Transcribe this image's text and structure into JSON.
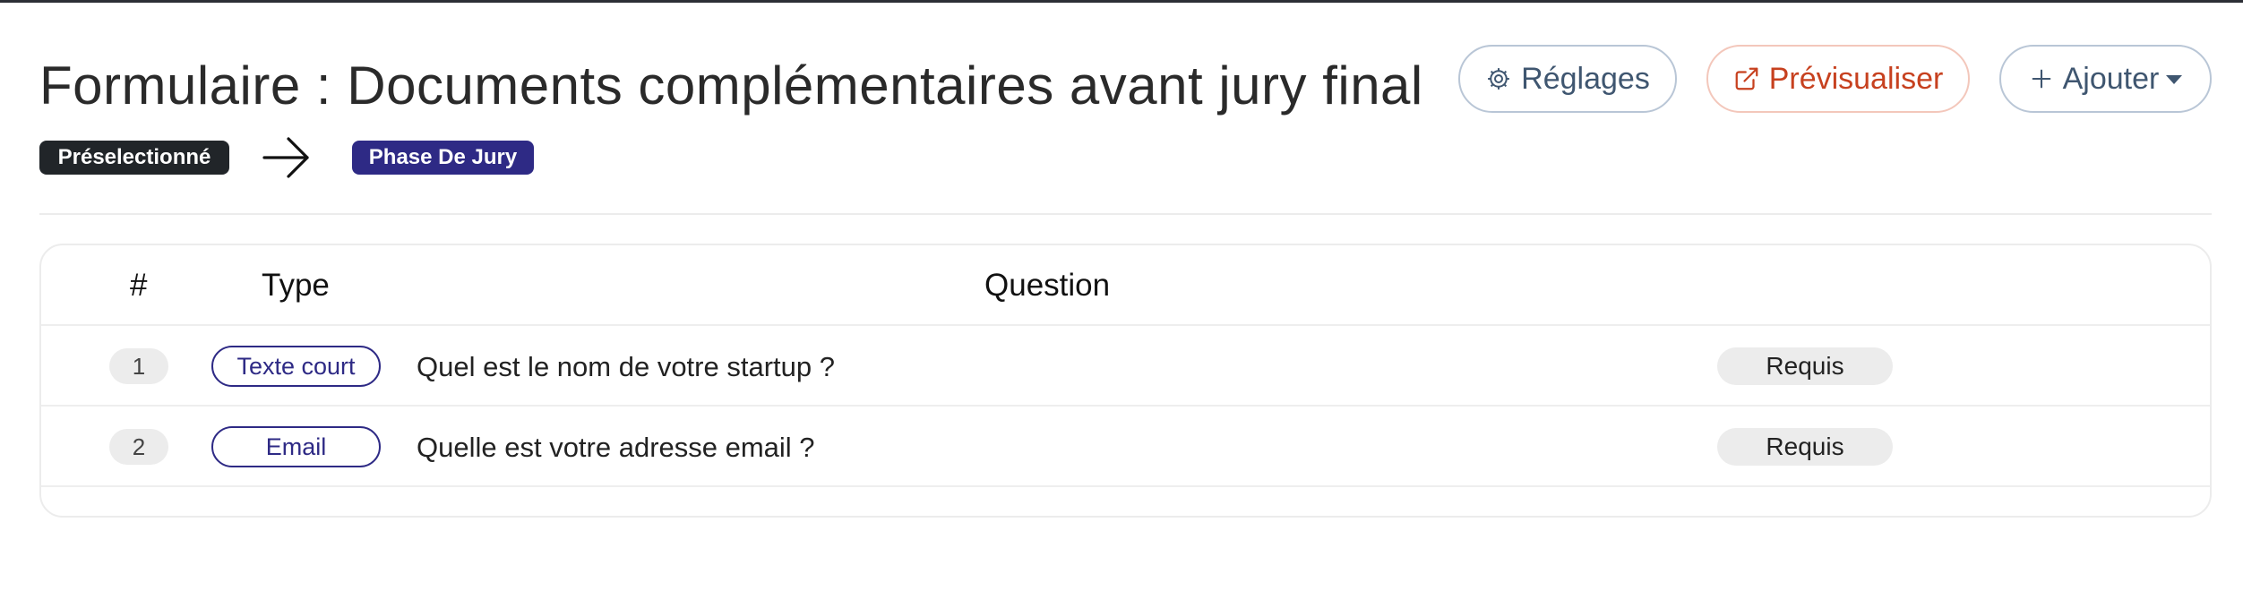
{
  "header": {
    "title": "Formulaire : Documents complémentaires avant jury final",
    "buttons": {
      "settings_label": "Réglages",
      "settings_icon": "gear-icon",
      "preview_label": "Prévisualiser",
      "preview_icon": "external-link-icon",
      "add_label": "Ajouter",
      "add_icon": "plus-icon"
    }
  },
  "transition": {
    "from_label": "Préselectionné",
    "to_label": "Phase De Jury",
    "arrow_icon": "arrow-right-icon"
  },
  "table": {
    "columns": [
      "#",
      "Type",
      "Question"
    ],
    "rows": [
      {
        "number": "1",
        "type": "Texte court",
        "question": "Quel est le nom de votre startup ?",
        "status": "Requis"
      },
      {
        "number": "2",
        "type": "Email",
        "question": "Quelle est votre adresse email ?",
        "status": "Requis"
      }
    ]
  },
  "colors": {
    "accent": "#2e2a85",
    "preview": "#c7411f",
    "badge_dark": "#212529",
    "button_text": "#3f5670"
  }
}
